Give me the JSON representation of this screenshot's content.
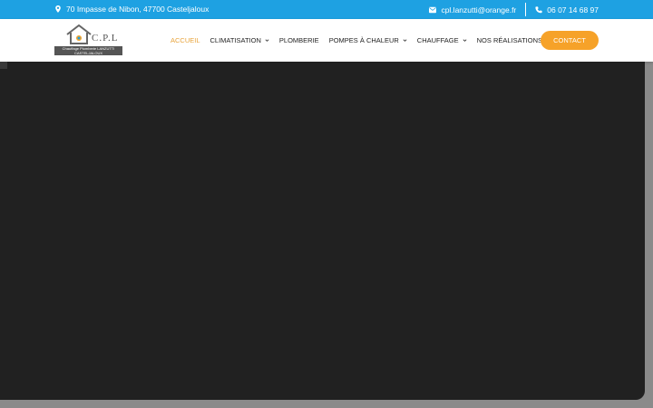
{
  "topbar": {
    "address": "70 Impasse de Nibon, 47700 Casteljaloux",
    "email": "cpl.lanzutti@orange.fr",
    "phone": "06 07 14 68 97"
  },
  "logo": {
    "brand": "C.P.L",
    "tagline": "Chauffage Plomberie LANZUTTI CASTELJALOUX"
  },
  "nav": [
    {
      "label": "ACCUEIL"
    },
    {
      "label": "CLIMATISATION"
    },
    {
      "label": "PLOMBERIE"
    },
    {
      "label": "POMPES À CHALEUR"
    },
    {
      "label": "CHAUFFAGE"
    },
    {
      "label": "NOS RÉALISATIONS"
    }
  ],
  "contact_label": "CONTACT",
  "colors": {
    "topbar": "#1ea1e2",
    "accent": "#f6a229",
    "active_nav": "#e8a33a"
  }
}
